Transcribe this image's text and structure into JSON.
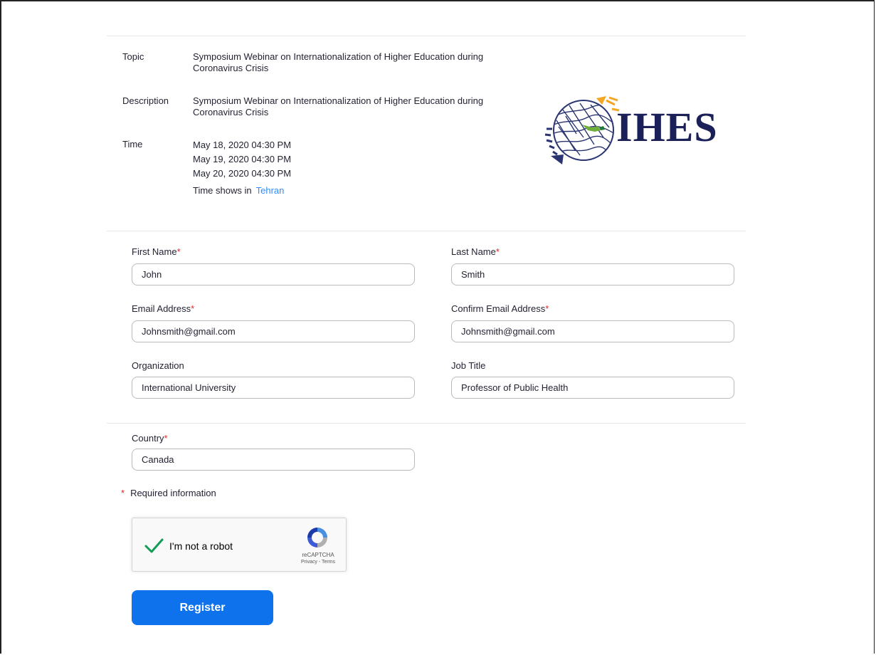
{
  "info": {
    "topic_label": "Topic",
    "topic_value": "Symposium Webinar on Internationalization of Higher Education during Coronavirus Crisis",
    "description_label": "Description",
    "description_value": "Symposium Webinar on Internationalization of Higher Education during Coronavirus Crisis",
    "time_label": "Time",
    "times": [
      "May 18, 2020 04:30 PM",
      "May 19, 2020 04:30 PM",
      "May 20, 2020 04:30 PM"
    ],
    "timezone_prefix": "Time shows in",
    "timezone_link": "Tehran"
  },
  "logo": {
    "text": "IHES",
    "color": "#1b2158"
  },
  "form": {
    "first_name": {
      "label": "First Name",
      "value": "John"
    },
    "last_name": {
      "label": "Last Name",
      "value": "Smith"
    },
    "email": {
      "label": "Email Address",
      "value": "Johnsmith@gmail.com"
    },
    "confirm_email": {
      "label": "Confirm Email Address",
      "value": "Johnsmith@gmail.com"
    },
    "organization": {
      "label": "Organization",
      "value": "International University"
    },
    "job_title": {
      "label": "Job Title",
      "value": "Professor of Public Health"
    },
    "country": {
      "label": "Country",
      "value": "Canada"
    },
    "required_marker": "*",
    "required_info": "Required information"
  },
  "captcha": {
    "label": "I'm not a robot",
    "brand": "reCAPTCHA",
    "links": "Privacy - Terms",
    "checked": true
  },
  "register_label": "Register",
  "colors": {
    "accent": "#0e72ed",
    "link": "#2d8cff",
    "required": "#e02828",
    "check": "#0f9d58"
  }
}
